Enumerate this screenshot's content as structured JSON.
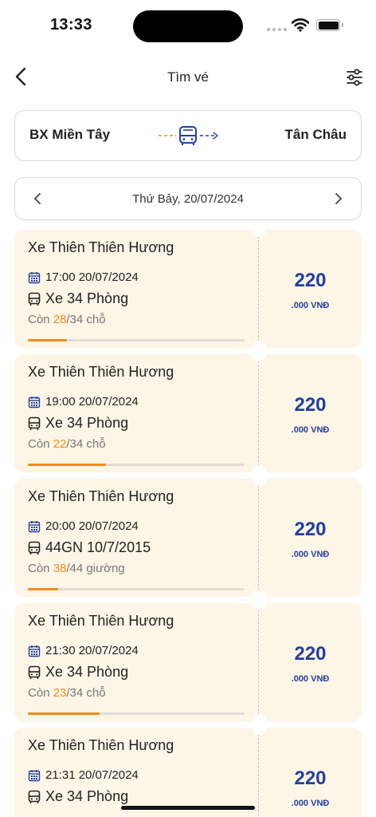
{
  "status_bar": {
    "time": "13:33"
  },
  "header": {
    "title": "Tìm vé"
  },
  "route": {
    "from": "BX Miền Tây",
    "to": "Tân Châu"
  },
  "date_selector": {
    "date": "Thứ Bảy, 20/07/2024"
  },
  "colors": {
    "accent": "#f08c1a",
    "price": "#233f9c",
    "card_bg": "#fdf5e6"
  },
  "trips": [
    {
      "operator": "Xe Thiên Thiên Hương",
      "departure": "17:00 20/07/2024",
      "vehicle": "Xe 34 Phòng",
      "seats_prefix": "Còn ",
      "seats_available": "28",
      "seats_suffix": "/34 chỗ",
      "progress": 0.18,
      "price_main": "220",
      "price_sub": ".000 VNĐ"
    },
    {
      "operator": "Xe Thiên Thiên Hương",
      "departure": "19:00 20/07/2024",
      "vehicle": "Xe 34 Phòng",
      "seats_prefix": "Còn ",
      "seats_available": "22",
      "seats_suffix": "/34 chỗ",
      "progress": 0.36,
      "price_main": "220",
      "price_sub": ".000 VNĐ"
    },
    {
      "operator": "Xe Thiên Thiên Hương",
      "departure": "20:00 20/07/2024",
      "vehicle": "44GN 10/7/2015",
      "seats_prefix": "Còn ",
      "seats_available": "38",
      "seats_suffix": "/44 giường",
      "progress": 0.14,
      "price_main": "220",
      "price_sub": ".000 VNĐ"
    },
    {
      "operator": "Xe Thiên Thiên Hương",
      "departure": "21:30 20/07/2024",
      "vehicle": "Xe 34 Phòng",
      "seats_prefix": "Còn ",
      "seats_available": "23",
      "seats_suffix": "/34 chỗ",
      "progress": 0.33,
      "price_main": "220",
      "price_sub": ".000 VNĐ"
    },
    {
      "operator": "Xe Thiên Thiên Hương",
      "departure": "21:31 20/07/2024",
      "vehicle": "Xe 34 Phòng",
      "price_main": "220",
      "price_sub": ".000 VNĐ"
    }
  ]
}
